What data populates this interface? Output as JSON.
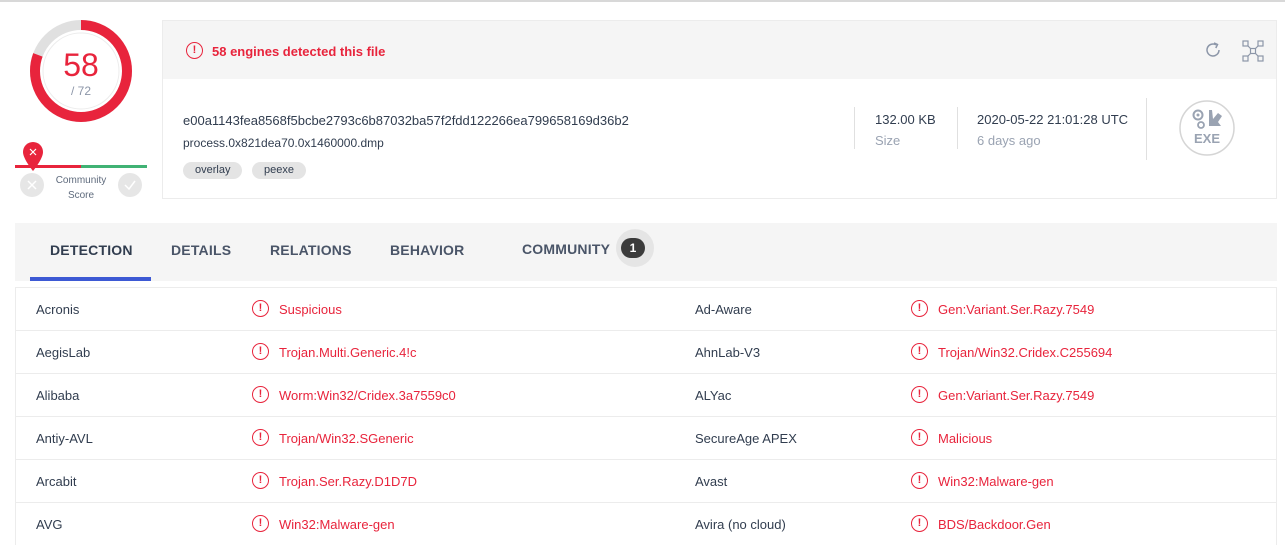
{
  "score": {
    "detected": "58",
    "total": "/ 72",
    "detected_fraction": 0.8056,
    "color": "#e8243c"
  },
  "community": {
    "label": "Community Score",
    "label_line1": "Community",
    "label_line2": "Score",
    "negative_icon": "x-icon",
    "positive_icon": "check-icon"
  },
  "file": {
    "alert_text": "58 engines detected this file",
    "sha256": "e00a1143fea8568f5bcbe2793c6b87032ba57f2fdd122266ea799658169d36b2",
    "name": "process.0x821dea70.0x1460000.dmp",
    "tags": [
      "overlay",
      "peexe"
    ],
    "size_value": "132.00 KB",
    "size_label": "Size",
    "date_value": "2020-05-22 21:01:28 UTC",
    "date_label": "6 days ago",
    "type_label": "EXE",
    "icons": [
      "reanalyze-icon",
      "graph-icon",
      "exe-file-icon"
    ]
  },
  "tabs": [
    {
      "label": "DETECTION",
      "active": true
    },
    {
      "label": "DETAILS"
    },
    {
      "label": "RELATIONS"
    },
    {
      "label": "BEHAVIOR"
    },
    {
      "label": "COMMUNITY",
      "badge": "1"
    }
  ],
  "detections": [
    {
      "left_engine": "Acronis",
      "left_result": "Suspicious",
      "right_engine": "Ad-Aware",
      "right_result": "Gen:Variant.Ser.Razy.7549"
    },
    {
      "left_engine": "AegisLab",
      "left_result": "Trojan.Multi.Generic.4!c",
      "right_engine": "AhnLab-V3",
      "right_result": "Trojan/Win32.Cridex.C255694"
    },
    {
      "left_engine": "Alibaba",
      "left_result": "Worm:Win32/Cridex.3a7559c0",
      "right_engine": "ALYac",
      "right_result": "Gen:Variant.Ser.Razy.7549"
    },
    {
      "left_engine": "Antiy-AVL",
      "left_result": "Trojan/Win32.SGeneric",
      "right_engine": "SecureAge APEX",
      "right_result": "Malicious"
    },
    {
      "left_engine": "Arcabit",
      "left_result": "Trojan.Ser.Razy.D1D7D",
      "right_engine": "Avast",
      "right_result": "Win32:Malware-gen"
    },
    {
      "left_engine": "AVG",
      "left_result": "Win32:Malware-gen",
      "right_engine": "Avira (no cloud)",
      "right_result": "BDS/Backdoor.Gen"
    }
  ],
  "alert_symbol": "!"
}
